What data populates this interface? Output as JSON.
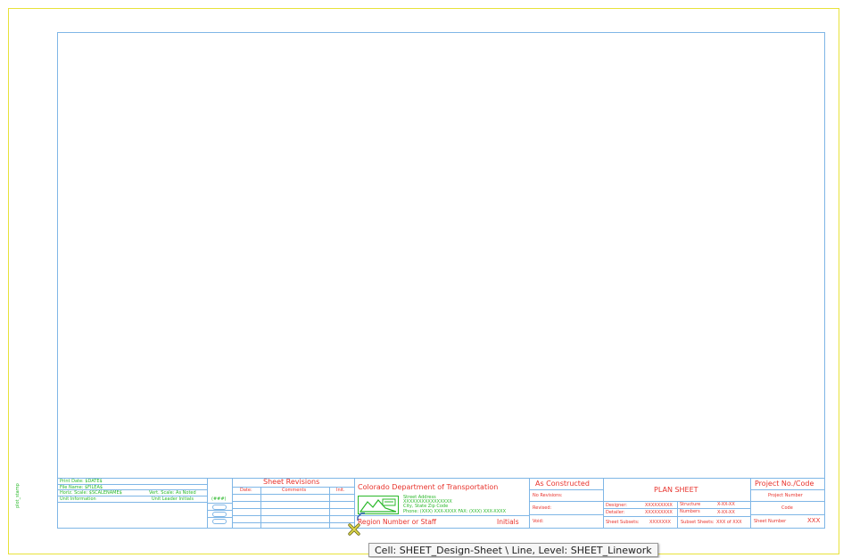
{
  "side_label": "plot_stamp",
  "left_info": {
    "print_date": "Print Date: $DATE$",
    "file_name": "File Name: $FILEA$",
    "horiz_scale": "Horiz. Scale: $SCALENAME$",
    "vert_scale": "Vert. Scale: As Noted",
    "unit_info": "Unit Information",
    "unit_leader": "Unit Leader Initials",
    "unit_code": "(###)"
  },
  "revisions": {
    "title": "Sheet Revisions",
    "headers": [
      "Date:",
      "Comments",
      "Init."
    ]
  },
  "cdot": {
    "title": "Colorado Department of Transportation",
    "address": [
      "Street Address",
      "XXXXXXXXXXXXXXXX",
      "City, State  Zip Code",
      "Phone: (XXX) XXX-XXXX  FAX: (XXX) XXX-XXXX"
    ],
    "region": "Region Number or Staff",
    "initials": "Initials"
  },
  "as_constructed": {
    "title": "As Constructed",
    "no_revisions": "No Revisions:",
    "revised": "Revised:",
    "void": "Void:"
  },
  "plan": {
    "title": "PLAN SHEET",
    "designer_label": "Designer:",
    "designer_value": "XXXXXXXXX",
    "detailer_label": "Detailer:",
    "detailer_value": "XXXXXXXXX",
    "structure_label": "Structure",
    "numbers_label": "Numbers",
    "structure_value": "X-XX-XX",
    "numbers_value": "X-XX-XX",
    "subsets_label": "Sheet Subsets:",
    "subsets_value": "XXXXXXX",
    "subset_sheets_label": "Subset Sheets:",
    "subset_sheets_value": "XXX  of  XXX"
  },
  "project": {
    "title": "Project No./Code",
    "number": "Project Number",
    "code": "Code",
    "sheet_number_label": "Sheet Number",
    "sheet_number_value": "XXX"
  },
  "tooltip": "Cell: SHEET_Design-Sheet \\ Line, Level: SHEET_Linework",
  "colors": {
    "frame": "#7fb6e6",
    "outer_frame": "#e8e23a",
    "green_text": "#29b829",
    "red_text": "#e8332c"
  }
}
